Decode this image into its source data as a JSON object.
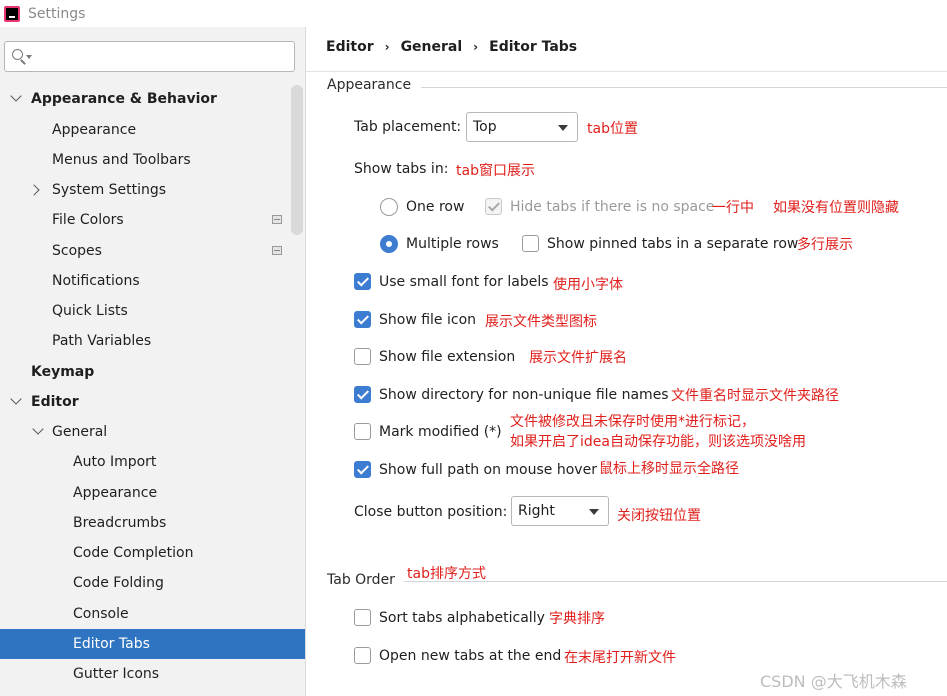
{
  "window": {
    "title": "Settings"
  },
  "search": {
    "placeholder": ""
  },
  "sidebar": {
    "items": [
      {
        "label": "Appearance & Behavior"
      },
      {
        "label": "Appearance"
      },
      {
        "label": "Menus and Toolbars"
      },
      {
        "label": "System Settings"
      },
      {
        "label": "File Colors"
      },
      {
        "label": "Scopes"
      },
      {
        "label": "Notifications"
      },
      {
        "label": "Quick Lists"
      },
      {
        "label": "Path Variables"
      },
      {
        "label": "Keymap"
      },
      {
        "label": "Editor"
      },
      {
        "label": "General"
      },
      {
        "label": "Auto Import"
      },
      {
        "label": "Appearance"
      },
      {
        "label": "Breadcrumbs"
      },
      {
        "label": "Code Completion"
      },
      {
        "label": "Code Folding"
      },
      {
        "label": "Console"
      },
      {
        "label": "Editor Tabs"
      },
      {
        "label": "Gutter Icons"
      }
    ]
  },
  "breadcrumb": [
    "Editor",
    "General",
    "Editor Tabs"
  ],
  "appearance": {
    "title": "Appearance",
    "tab_placement_label": "Tab placement:",
    "tab_placement_value": "Top",
    "show_tabs_in_label": "Show tabs in:",
    "one_row": "One row",
    "hide_tabs": "Hide tabs if there is no space",
    "multiple_rows": "Multiple rows",
    "show_pinned": "Show pinned tabs in a separate row",
    "small_font": "Use small font for labels",
    "file_icon": "Show file icon",
    "file_extension": "Show file extension",
    "directory": "Show directory for non-unique file names",
    "mark_modified": "Mark modified (*)",
    "full_path": "Show full path on mouse hover",
    "close_button_label": "Close button position:",
    "close_button_value": "Right"
  },
  "tab_order": {
    "title": "Tab Order",
    "sort_alpha": "Sort tabs alphabetically",
    "open_new_end": "Open new tabs at the end"
  },
  "notes": {
    "tab_placement": "tab位置",
    "show_tabs_in": "tab窗口展示",
    "one_row": "一行中",
    "hide_tabs": "如果没有位置则隐藏",
    "multiple_rows": "多行展示",
    "small_font": "使用小字体",
    "file_icon": "展示文件类型图标",
    "file_extension": "展示文件扩展名",
    "directory": "文件重名时显示文件夹路径",
    "mark_modified_1": "文件被修改且未保存时使用*进行标记，",
    "mark_modified_2": "如果开启了idea自动保存功能，则该选项没啥用",
    "full_path": "鼠标上移时显示全路径",
    "close_button": "关闭按钮位置",
    "tab_order": "tab排序方式",
    "sort_alpha": "字典排序",
    "open_new_end": "在末尾打开新文件"
  },
  "watermark": "CSDN @大飞机木森"
}
